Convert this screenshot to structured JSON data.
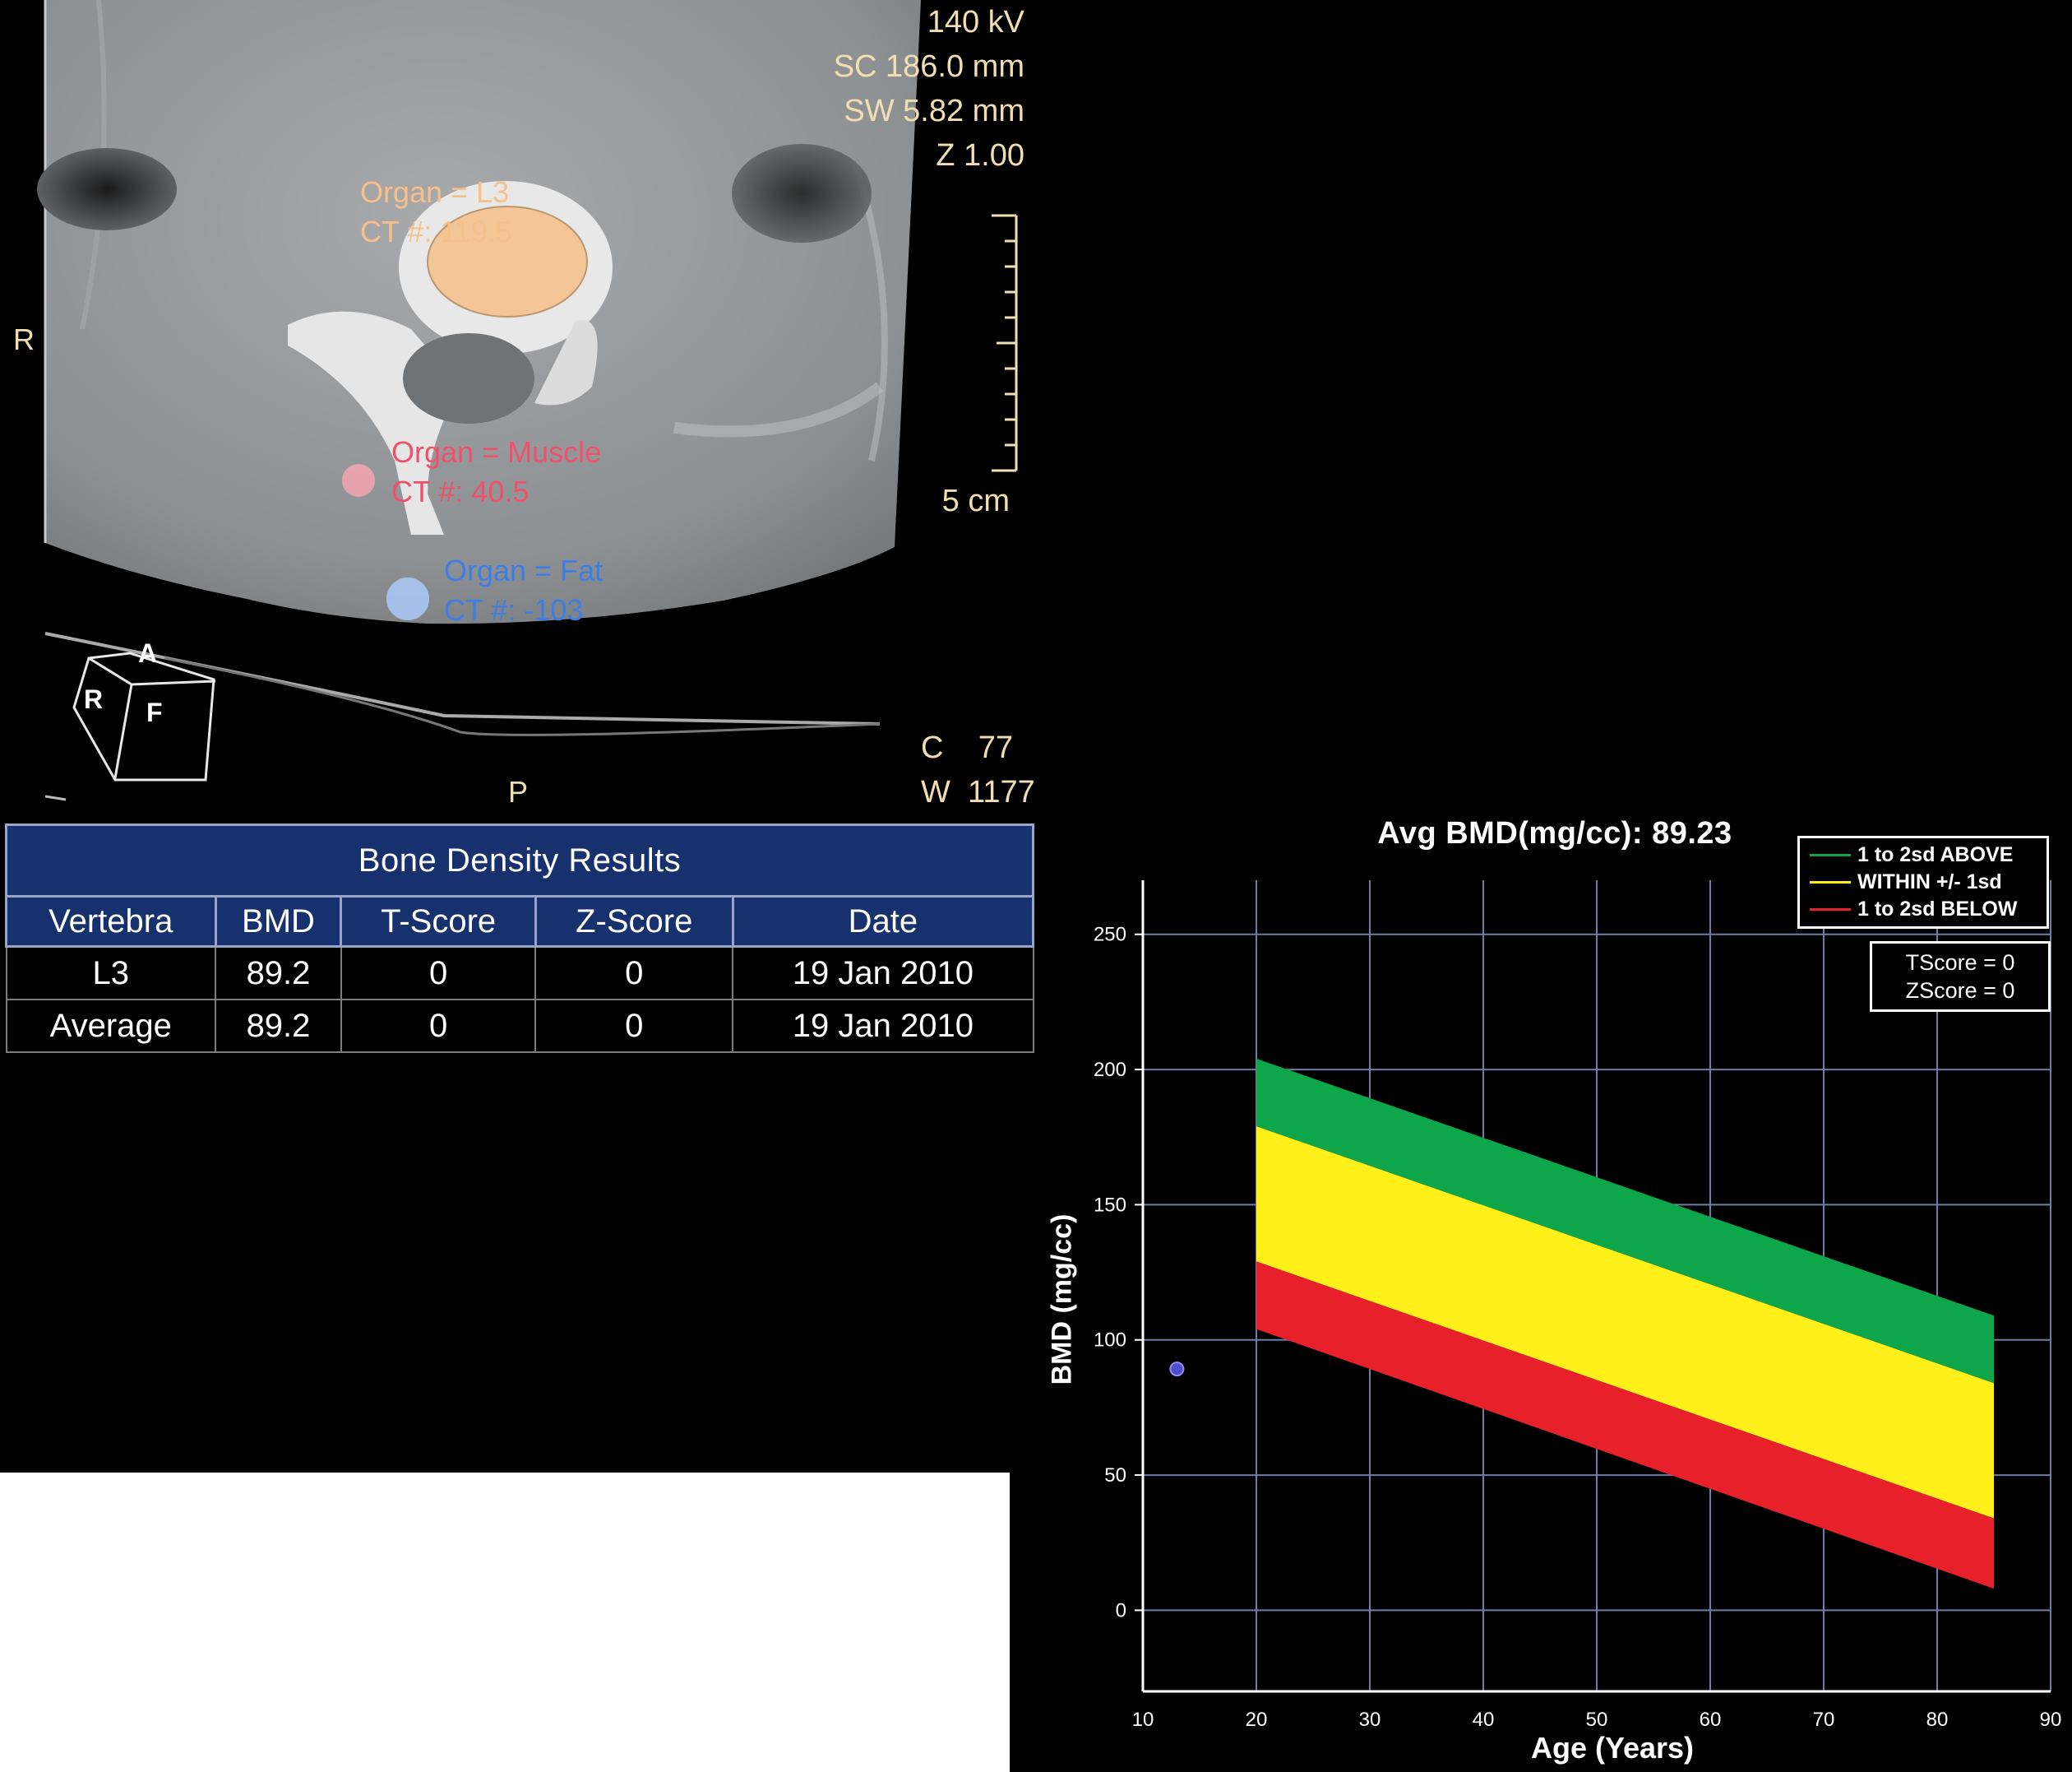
{
  "ct_viewer": {
    "acquisition": {
      "kv": "140 kV",
      "sc": "SC 186.0 mm",
      "sw": "SW 5.82 mm",
      "zoom": "Z 1.00"
    },
    "scale_label": "5 cm",
    "orientation": {
      "left": "R",
      "bottom": "P"
    },
    "cube_labels": {
      "top": "A",
      "left": "R",
      "front": "F"
    },
    "window": {
      "center_label": "C",
      "center_value": "77",
      "width_label": "W",
      "width_value": "1177"
    },
    "rois": [
      {
        "organ": "Organ = L3",
        "ct": "CT #: 119.5",
        "color": "#f6c08a"
      },
      {
        "organ": "Organ = Muscle",
        "ct": "CT #: 40.5",
        "color": "#f0506a"
      },
      {
        "organ": "Organ = Fat",
        "ct": "CT #: -103",
        "color": "#3c7de6"
      }
    ]
  },
  "results_table": {
    "title": "Bone Density Results",
    "columns": [
      "Vertebra",
      "BMD",
      "T-Score",
      "Z-Score",
      "Date"
    ],
    "rows": [
      [
        "L3",
        "89.2",
        "0",
        "0",
        "19 Jan 2010"
      ],
      [
        "Average",
        "89.2",
        "0",
        "0",
        "19 Jan 2010"
      ]
    ]
  },
  "chart_data": {
    "type": "area",
    "title": "Avg BMD(mg/cc): 89.23",
    "xlabel": "Age (Years)",
    "ylabel": "BMD (mg/cc)",
    "xlim": [
      10,
      90
    ],
    "ylim": [
      -30,
      270
    ],
    "xticks": [
      10,
      20,
      30,
      40,
      50,
      60,
      70,
      80,
      90
    ],
    "yticks": [
      0,
      50,
      100,
      150,
      200,
      250
    ],
    "grid": true,
    "legend_position": "top-right",
    "bands": [
      {
        "name": "1 to 2sd ABOVE",
        "color": "#0ea64a",
        "x": [
          20,
          85
        ],
        "upper": [
          204,
          109
        ],
        "lower": [
          179,
          84
        ]
      },
      {
        "name": "WITHIN +/- 1sd",
        "color": "#fff01a",
        "x": [
          20,
          85
        ],
        "upper": [
          179,
          84
        ],
        "lower": [
          129,
          34
        ]
      },
      {
        "name": "1 to 2sd BELOW",
        "color": "#e8202a",
        "x": [
          20,
          85
        ],
        "upper": [
          129,
          34
        ],
        "lower": [
          104,
          8
        ]
      }
    ],
    "points": [
      {
        "x": 13,
        "y": 89.23,
        "color": "#4b4fd0"
      }
    ],
    "score_box": {
      "tscore": "TScore = 0",
      "zscore": "ZScore = 0"
    }
  }
}
